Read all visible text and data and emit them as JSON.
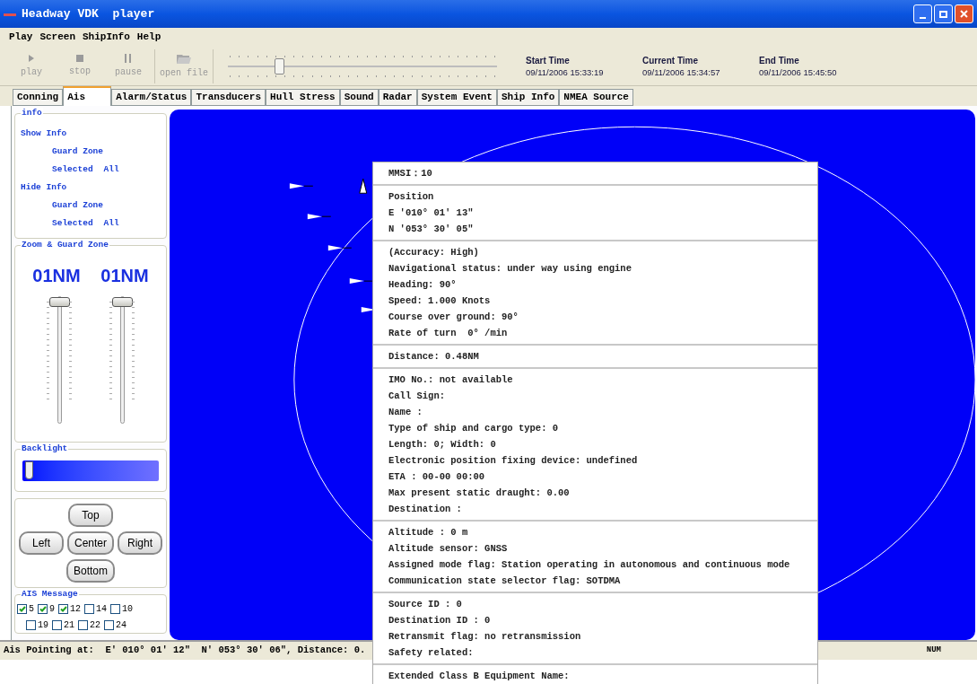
{
  "window": {
    "title": "Headway VDK  player"
  },
  "menu": [
    "Play",
    "Screen",
    "ShipInfo",
    "Help"
  ],
  "toolbar": [
    {
      "label": "play",
      "kind": "play",
      "disabled": true
    },
    {
      "label": "stop",
      "kind": "stop",
      "disabled": true
    },
    {
      "label": "pause",
      "kind": "pause",
      "disabled": true
    },
    {
      "label": "open file",
      "kind": "open",
      "disabled": true
    }
  ],
  "timeline": {
    "level": 0.18
  },
  "times": [
    {
      "label": "Start Time",
      "value": "09/11/2006 15:33:19"
    },
    {
      "label": "Current Time",
      "value": "09/11/2006 15:34:57"
    },
    {
      "label": "End Time",
      "value": "09/11/2006 15:45:50"
    }
  ],
  "tabs": [
    {
      "label": "Conning",
      "selected": false
    },
    {
      "label": "Ais",
      "selected": true
    },
    {
      "label": "Alarm/Status",
      "selected": false
    },
    {
      "label": "Transducers",
      "selected": false
    },
    {
      "label": "Hull Stress",
      "selected": false
    },
    {
      "label": "Sound",
      "selected": false
    },
    {
      "label": "Radar",
      "selected": false
    },
    {
      "label": "System Event",
      "selected": false
    },
    {
      "label": "Ship Info",
      "selected": false
    },
    {
      "label": "NMEA Source",
      "selected": false
    }
  ],
  "info": {
    "title": "info",
    "groups": [
      {
        "heading": "Show Info",
        "guard": "Guard Zone",
        "selected": "Selected",
        "all": "All"
      },
      {
        "heading": "Hide Info",
        "guard": "Guard Zone",
        "selected": "Selected",
        "all": "All"
      }
    ]
  },
  "zoom": {
    "title": "Zoom & Guard Zone",
    "sliders": [
      {
        "reading": "01NM",
        "level": 1
      },
      {
        "reading": "01NM",
        "level": 1
      }
    ]
  },
  "backlight": {
    "title": "Backlight",
    "level": 0.02
  },
  "nav_buttons": {
    "top": "Top",
    "left": "Left",
    "center": "Center",
    "right": "Right",
    "bottom": "Bottom"
  },
  "ais_message": {
    "title": "AIS Message",
    "rows": [
      [
        {
          "label": "5",
          "checked": true
        },
        {
          "label": "9",
          "checked": true
        },
        {
          "label": "12",
          "checked": true
        },
        {
          "label": "14",
          "checked": false
        },
        {
          "label": "10",
          "checked": false
        }
      ],
      [
        {
          "label": "19",
          "checked": false
        },
        {
          "label": "21",
          "checked": false
        },
        {
          "label": "22",
          "checked": false
        },
        {
          "label": "24",
          "checked": false
        }
      ]
    ]
  },
  "popup": {
    "sections": [
      [
        "MMSI：10"
      ],
      [
        "Position",
        "E '010° 01' 13\"",
        "N '053° 30' 05\""
      ],
      [
        "(Accuracy: High)",
        "Navigational status: under way using engine",
        "Heading: 90°",
        "Speed: 1.000 Knots",
        "Course over ground: 90°",
        "Rate of turn  0° /min"
      ],
      [
        "Distance: 0.48NM"
      ],
      [
        "IMO No.: not available",
        "Call Sign:",
        "Name :",
        "Type of ship and cargo type: 0",
        "Length: 0; Width: 0",
        "Electronic position fixing device: undefined",
        "ETA : 00-00 00:00",
        "Max present static draught: 0.00",
        "Destination :"
      ],
      [
        "Altitude : 0 m",
        "Altitude sensor: GNSS",
        "Assigned mode flag: Station operating in autonomous and continuous mode",
        "Communication state selector flag: SOTDMA"
      ],
      [
        "Source ID : 0",
        "Destination ID : 0",
        "Retransmit flag: no retransmission",
        "Safety related:"
      ],
      [
        "Extended Class B Equipment Name:"
      ]
    ]
  },
  "status_bar": {
    "text": "Ais Pointing at:  E' 010° 01' 12\"  N' 053° 30' 06\", Distance: 0.",
    "indicator": "NUM"
  }
}
